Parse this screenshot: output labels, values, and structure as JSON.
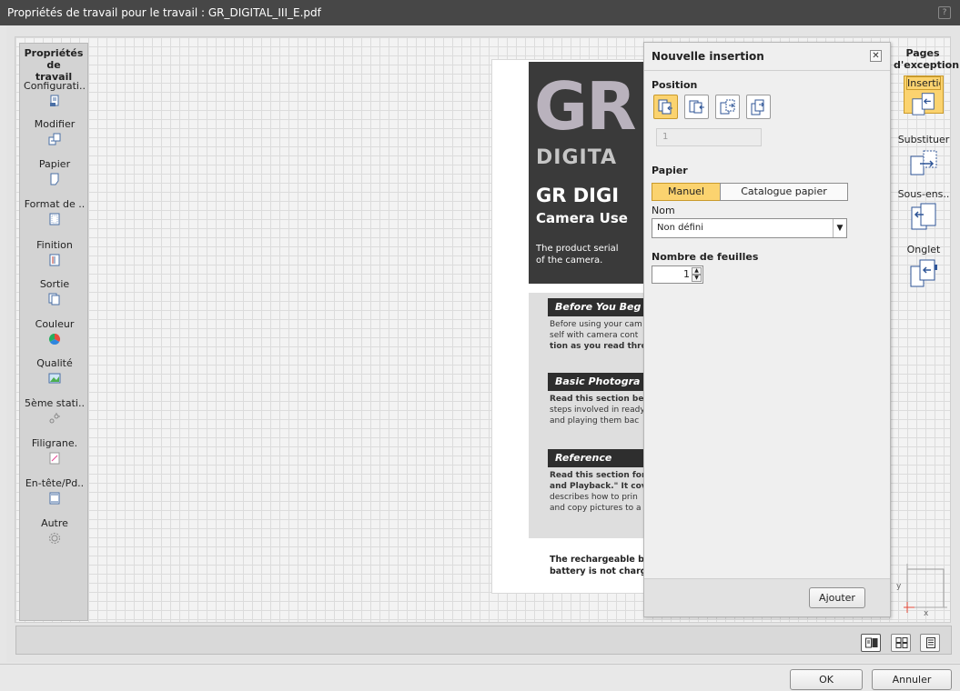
{
  "window": {
    "title": "Propriétés de travail pour le travail : GR_DIGITAL_III_E.pdf",
    "help_glyph": "?"
  },
  "left_panel": {
    "title_line1": "Propriétés de",
    "title_line2": "travail",
    "items": [
      {
        "label": "Configurati..",
        "icon": "configuration-icon"
      },
      {
        "label": "Modifier",
        "icon": "edit-icon"
      },
      {
        "label": "Papier",
        "icon": "paper-icon"
      },
      {
        "label": "Format de ..",
        "icon": "format-icon"
      },
      {
        "label": "Finition",
        "icon": "finishing-icon"
      },
      {
        "label": "Sortie",
        "icon": "output-icon"
      },
      {
        "label": "Couleur",
        "icon": "color-icon"
      },
      {
        "label": "Qualité",
        "icon": "quality-icon"
      },
      {
        "label": "5ème stati..",
        "icon": "fifth-station-icon"
      },
      {
        "label": "Filigrane.",
        "icon": "watermark-icon"
      },
      {
        "label": "En-tête/Pd..",
        "icon": "header-footer-icon"
      },
      {
        "label": "Autre",
        "icon": "gear-icon"
      }
    ]
  },
  "preview": {
    "gr": "GR",
    "digital": "DIGITA",
    "heading": "GR DIGI",
    "subheading": "Camera Use",
    "product_line1": "The product serial",
    "product_line2": "of the camera.",
    "band1": "Before You Beg",
    "text1_line1": "Before using your cam",
    "text1_line2": "self with camera cont",
    "text1_line3": "tion as you read through th",
    "band2": "Basic Photogra",
    "text2_line1": "Read this section before u",
    "text2_line2": "steps involved in ready",
    "text2_line3": "and playing them bac",
    "band3": "Reference",
    "text3_line1": "Read this section for info",
    "text3_line2": "and Playback.\" It covers a",
    "text3_line3": "describes how to prin",
    "text3_line4": "and copy pictures to a",
    "foot_line1": "The rechargeable bat",
    "foot_line2": "battery is not charged"
  },
  "dialog": {
    "title": "Nouvelle insertion",
    "close_glyph": "✕",
    "position_label": "Position",
    "position_buttons": [
      {
        "name": "insert-before-first",
        "selected": true
      },
      {
        "name": "insert-before-page",
        "selected": false
      },
      {
        "name": "insert-after-page",
        "selected": false
      },
      {
        "name": "insert-after-last",
        "selected": false
      }
    ],
    "page_number_value": "1",
    "paper_label": "Papier",
    "paper_tabs": [
      {
        "label": "Manuel",
        "selected": true
      },
      {
        "label": "Catalogue papier",
        "selected": false
      }
    ],
    "name_label": "Nom",
    "name_value": "Non défini",
    "sheets_label": "Nombre de feuilles",
    "sheets_value": "1",
    "add_button": "Ajouter"
  },
  "right_panel": {
    "title_line1": "Pages",
    "title_line2": "d'exception",
    "items": [
      {
        "label": "Insertion",
        "selected": true
      },
      {
        "label": "Substituer",
        "selected": false
      },
      {
        "label": "Sous-ens..",
        "selected": false
      },
      {
        "label": "Onglet",
        "selected": false
      }
    ]
  },
  "axes": {
    "y_label": "y",
    "x_label": "x"
  },
  "view_buttons": [
    {
      "name": "book-view",
      "selected": true
    },
    {
      "name": "grid-view",
      "selected": false
    },
    {
      "name": "list-view",
      "selected": false
    }
  ],
  "footer": {
    "ok": "OK",
    "cancel": "Annuler"
  },
  "colors": {
    "accent": "#fbd36f",
    "accent_border": "#c99a2c",
    "titlebar": "#474747"
  }
}
